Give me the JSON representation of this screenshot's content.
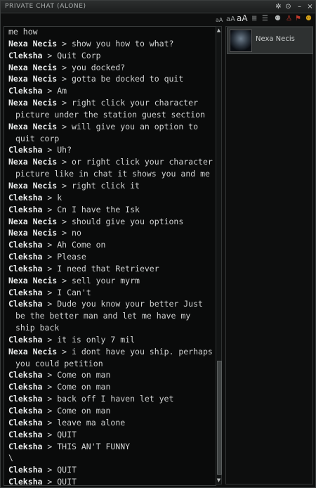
{
  "window": {
    "title": "PRIVATE CHAT (ALONE)"
  },
  "titlebar": {
    "pin": "✲",
    "settings": "⊙",
    "minimize": "–",
    "close": "×"
  },
  "toolbar": {
    "font_small": "aA",
    "font_medium": "aA",
    "font_large": "aA",
    "list_icon": "≣",
    "list_icon_2": "☰",
    "users_icon": "⚉",
    "person_icon": "♙",
    "flag_icon": "⚑"
  },
  "members": [
    {
      "name": "Nexa Necis"
    }
  ],
  "messages": [
    {
      "sender": "",
      "text": "me how"
    },
    {
      "sender": "Nexa Necis",
      "text": " > show you how to what?"
    },
    {
      "sender": "Cleksha",
      "text": " > Quit Corp"
    },
    {
      "sender": "Nexa Necis",
      "text": " > you docked?"
    },
    {
      "sender": "Nexa Necis",
      "text": " > gotta be docked to quit"
    },
    {
      "sender": "Cleksha",
      "text": " > Am"
    },
    {
      "sender": "Nexa Necis",
      "text": " > right click your character picture under the station guest section"
    },
    {
      "sender": "Nexa Necis",
      "text": " > will give you an option to quit corp"
    },
    {
      "sender": "Cleksha",
      "text": " > Uh?"
    },
    {
      "sender": "Nexa Necis",
      "text": " > or right click your character picture like in chat it shows you and me"
    },
    {
      "sender": "Nexa Necis",
      "text": " > right click it"
    },
    {
      "sender": "Cleksha",
      "text": " > k"
    },
    {
      "sender": "Cleksha",
      "text": " > Cn I have the Isk"
    },
    {
      "sender": "Nexa Necis",
      "text": " > should give you options"
    },
    {
      "sender": "Nexa Necis",
      "text": " > no"
    },
    {
      "sender": "Cleksha",
      "text": " > Ah Come on"
    },
    {
      "sender": "Cleksha",
      "text": " > Please"
    },
    {
      "sender": "Cleksha",
      "text": " > I need that Retriever"
    },
    {
      "sender": "Nexa Necis",
      "text": " > sell your myrm"
    },
    {
      "sender": "Cleksha",
      "text": " > I Can't"
    },
    {
      "sender": "Cleksha",
      "text": " > Dude you know your better Just be the better man and let me have my ship back"
    },
    {
      "sender": "Cleksha",
      "text": " > it is only 7 mil"
    },
    {
      "sender": "Nexa Necis",
      "text": " > i dont have you ship. perhaps you could petition"
    },
    {
      "sender": "Cleksha",
      "text": " > Come on man"
    },
    {
      "sender": "Cleksha",
      "text": " > Come on man"
    },
    {
      "sender": "Cleksha",
      "text": " > back off I haven let yet"
    },
    {
      "sender": "Cleksha",
      "text": " > Come on man"
    },
    {
      "sender": "Cleksha",
      "text": " > leave ma alone"
    },
    {
      "sender": "Cleksha",
      "text": " > QUIT"
    },
    {
      "sender": "Cleksha",
      "text": " > THIS AN'T FUNNY"
    },
    {
      "sender": "",
      "text": "\\"
    },
    {
      "sender": "Cleksha",
      "text": " > QUIT"
    },
    {
      "sender": "Cleksha",
      "text": " > QUIT"
    }
  ]
}
